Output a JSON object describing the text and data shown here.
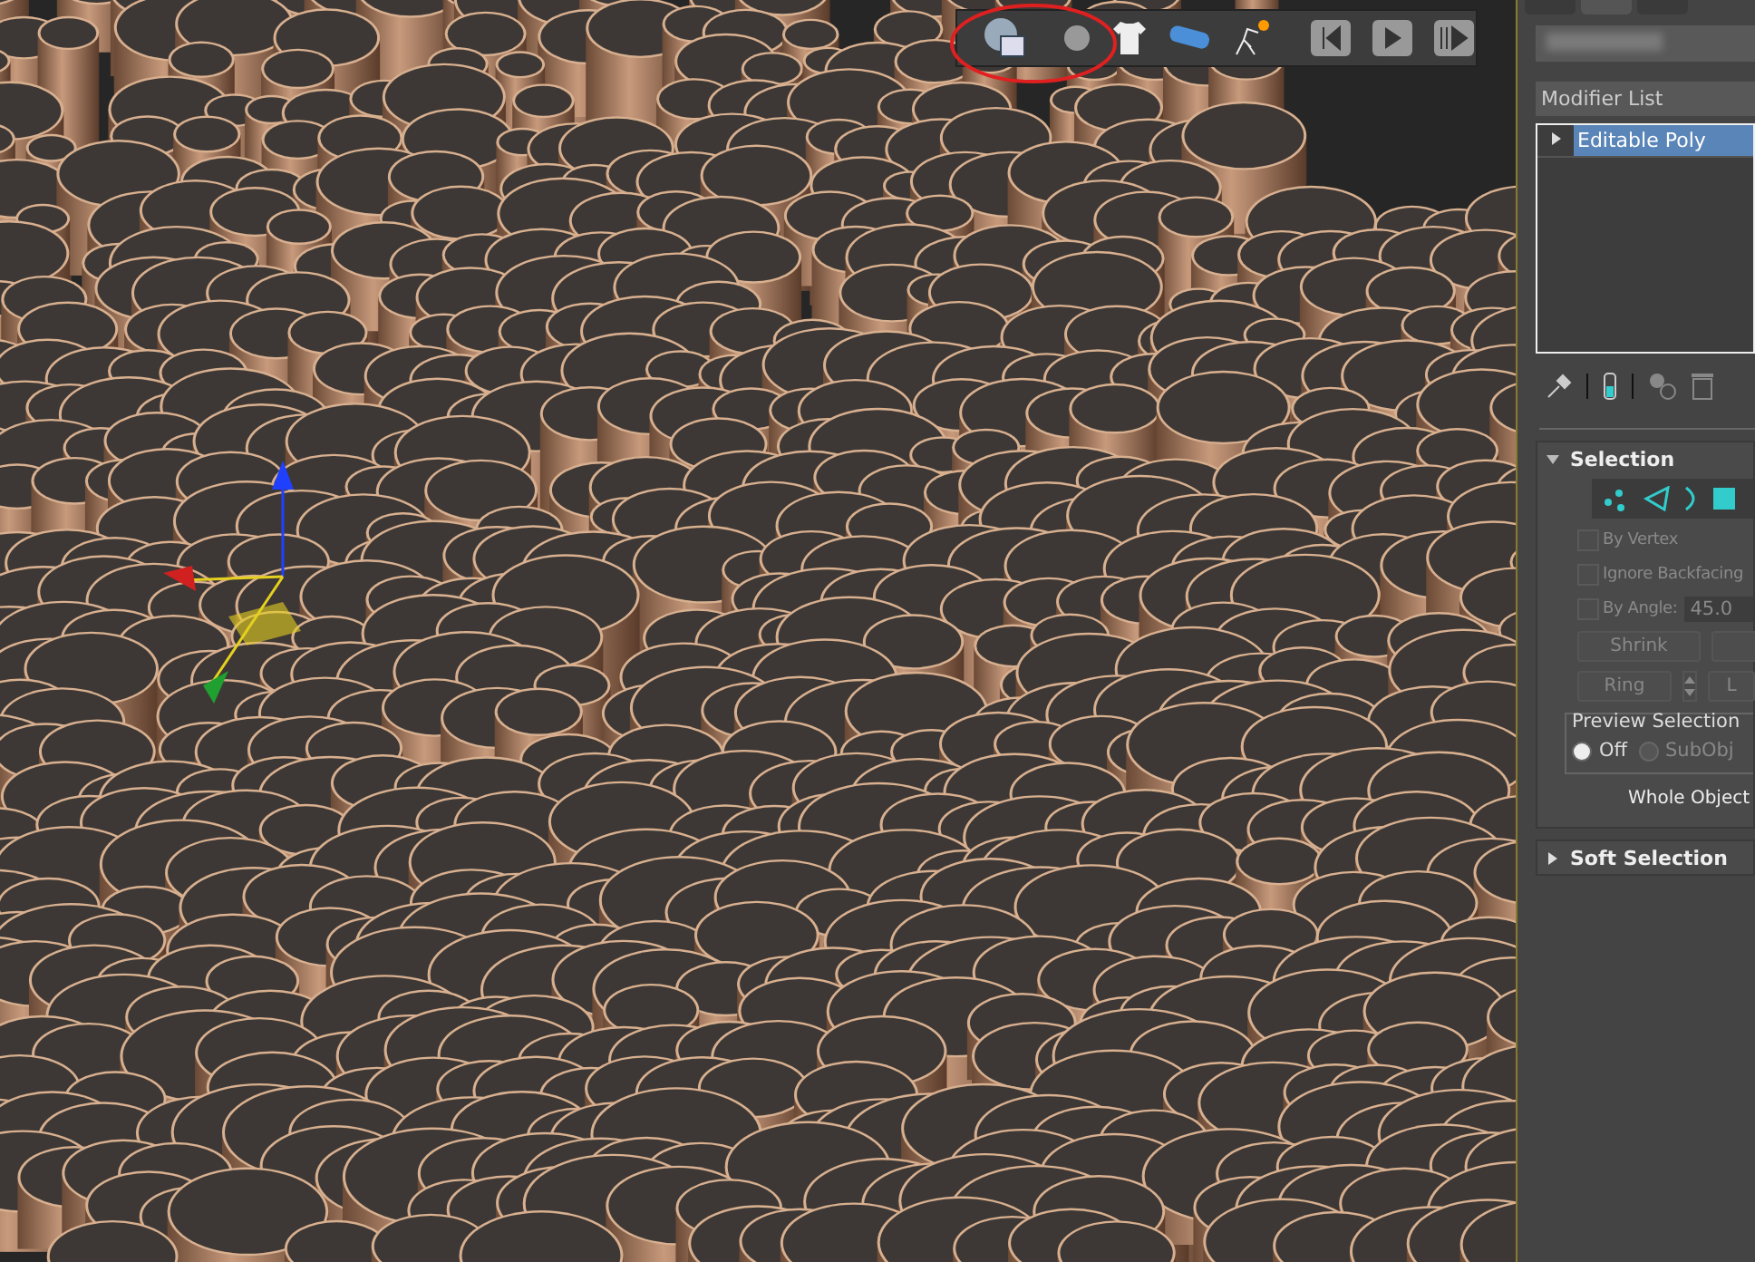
{
  "panel_tabs": [
    {
      "selected": false
    },
    {
      "selected": true
    },
    {
      "selected": false
    }
  ],
  "modifier_list": {
    "placeholder": "Modifier List"
  },
  "modifier_stack": [
    {
      "label": "Editable Poly",
      "selected": true,
      "expanded": false
    }
  ],
  "rollouts": [
    {
      "title": "Selection",
      "expanded": true,
      "checkboxes": [
        {
          "label": "By Vertex",
          "checked": false,
          "disabled": true
        },
        {
          "label": "Ignore Backfacing",
          "checked": false,
          "disabled": true
        },
        {
          "label": "By Angle:",
          "checked": false,
          "disabled": true,
          "value": "45.0"
        }
      ],
      "buttons": [
        [
          "Shrink"
        ],
        [
          "Ring",
          "L"
        ]
      ],
      "preview": {
        "title": "Preview Selection",
        "options": [
          {
            "label": "Off",
            "selected": true
          },
          {
            "label": "SubObj",
            "selected": false
          }
        ]
      },
      "status": "Whole Object"
    },
    {
      "title": "Soft Selection",
      "expanded": false
    }
  ]
}
